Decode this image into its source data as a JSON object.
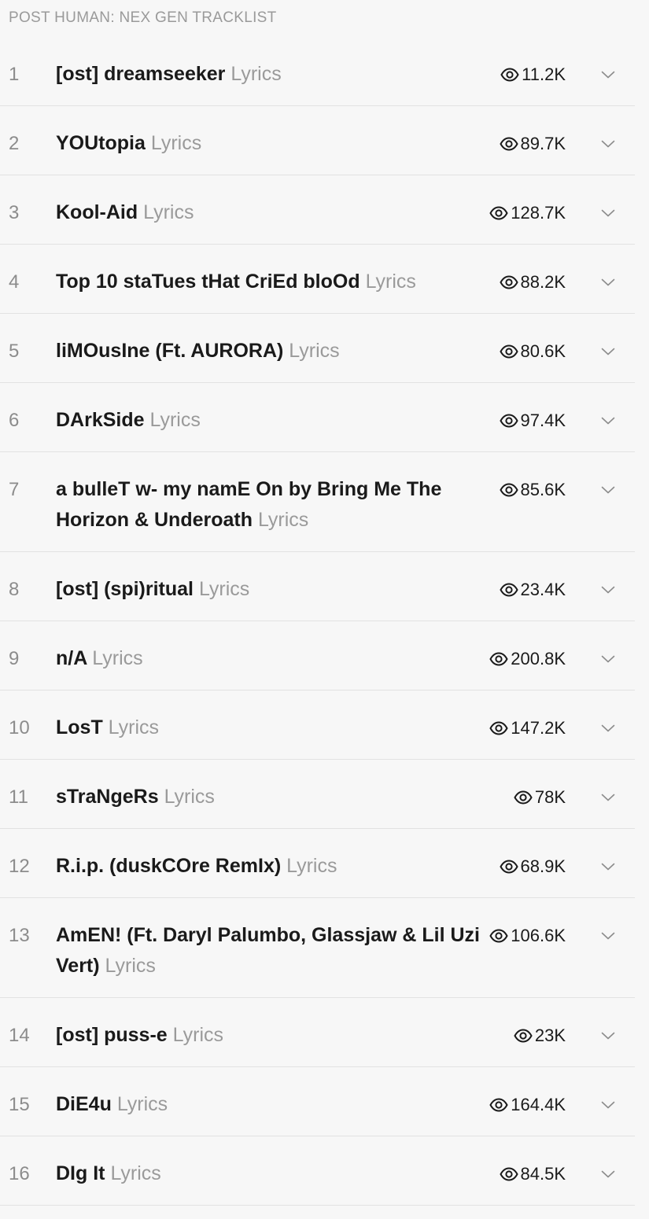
{
  "tracklist": {
    "heading": "POST HUMAN: NEX GEN TRACKLIST",
    "lyrics_label": "Lyrics",
    "tracks": [
      {
        "number": "1",
        "title": "[ost] dreamseeker",
        "views": "11.2K"
      },
      {
        "number": "2",
        "title": "YOUtopia",
        "views": "89.7K"
      },
      {
        "number": "3",
        "title": "Kool-Aid",
        "views": "128.7K"
      },
      {
        "number": "4",
        "title": "Top 10 staTues tHat CriEd bloOd",
        "views": "88.2K"
      },
      {
        "number": "5",
        "title": "liMOusIne (Ft. AURORA)",
        "views": "80.6K"
      },
      {
        "number": "6",
        "title": "DArkSide",
        "views": "97.4K"
      },
      {
        "number": "7",
        "title": "a bulleT w- my namE On by Bring Me The Horizon & Underoath",
        "views": "85.6K"
      },
      {
        "number": "8",
        "title": "[ost] (spi)ritual",
        "views": "23.4K"
      },
      {
        "number": "9",
        "title": "n/A",
        "views": "200.8K"
      },
      {
        "number": "10",
        "title": "LosT",
        "views": "147.2K"
      },
      {
        "number": "11",
        "title": "sTraNgeRs",
        "views": "78K"
      },
      {
        "number": "12",
        "title": "R.i.p. (duskCOre RemIx)",
        "views": "68.9K"
      },
      {
        "number": "13",
        "title": "AmEN! (Ft. Daryl Palumbo, Glassjaw & Lil Uzi Vert)",
        "views": "106.6K"
      },
      {
        "number": "14",
        "title": "[ost] puss-e",
        "views": "23K"
      },
      {
        "number": "15",
        "title": "DiE4u",
        "views": "164.4K"
      },
      {
        "number": "16",
        "title": "DIg It",
        "views": "84.5K"
      }
    ]
  }
}
